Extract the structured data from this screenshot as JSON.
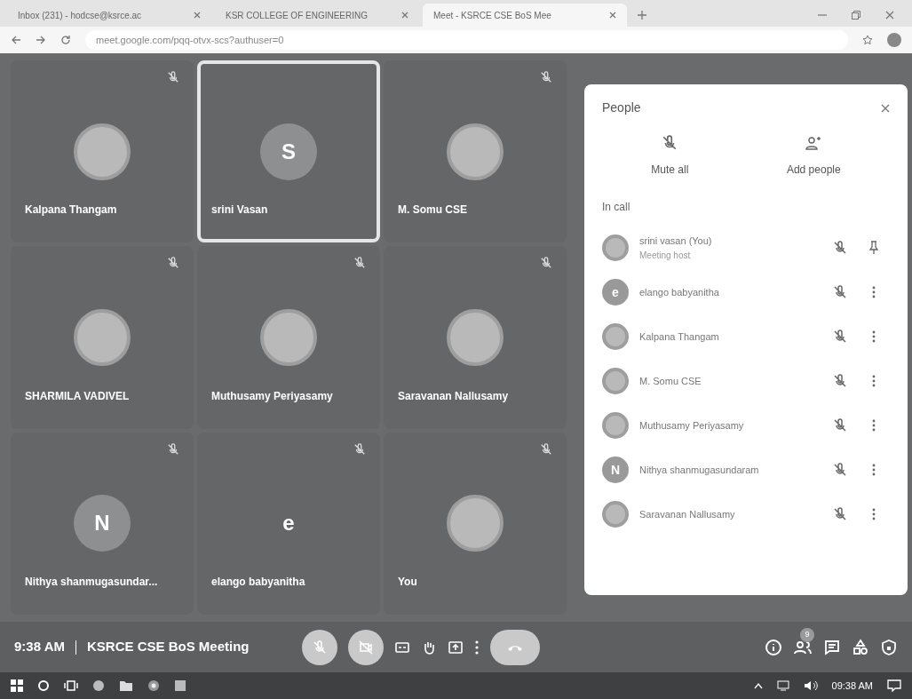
{
  "browser": {
    "tabs": [
      {
        "label": "Inbox (231) - hodcse@ksrce.ac",
        "selected": false
      },
      {
        "label": "KSR COLLEGE OF ENGINEERING",
        "selected": false
      },
      {
        "label": "Meet - KSRCE CSE BoS Mee",
        "selected": true
      }
    ],
    "url": "meet.google.com/pqq-otvx-scs?authuser=0"
  },
  "tiles": [
    {
      "name": "Kalpana Thangam",
      "kind": "photo",
      "muted": true,
      "selected": false
    },
    {
      "name": "srini Vasan",
      "kind": "letter",
      "initial": "S",
      "muted": false,
      "selected": true
    },
    {
      "name": "M. Somu CSE",
      "kind": "photo",
      "muted": true,
      "selected": false
    },
    {
      "name": "SHARMILA VADIVEL",
      "kind": "photo",
      "muted": true,
      "selected": false
    },
    {
      "name": "Muthusamy Periyasamy",
      "kind": "photo",
      "muted": true,
      "selected": false
    },
    {
      "name": "Saravanan Nallusamy",
      "kind": "photo",
      "muted": true,
      "selected": false
    },
    {
      "name": "Nithya shanmugasundar...",
      "kind": "letter",
      "initial": "N",
      "muted": true,
      "selected": false
    },
    {
      "name": "elango babyanitha",
      "kind": "plain",
      "initial": "e",
      "muted": true,
      "selected": false
    },
    {
      "name": "You",
      "kind": "photo",
      "muted": true,
      "selected": false
    }
  ],
  "people_panel": {
    "title": "People",
    "actions": [
      "Mute all",
      "Add people"
    ],
    "section": "In call",
    "participants": [
      {
        "name": "srini vasan (You)",
        "role": "Meeting host",
        "kind": "photo",
        "pinned": true
      },
      {
        "name": "elango babyanitha",
        "kind": "letter",
        "initial": "e",
        "pinned": false
      },
      {
        "name": "Kalpana Thangam",
        "kind": "photo",
        "pinned": false
      },
      {
        "name": "M. Somu CSE",
        "kind": "photo",
        "pinned": false
      },
      {
        "name": "Muthusamy Periyasamy",
        "kind": "photo",
        "pinned": false
      },
      {
        "name": "Nithya shanmugasundaram",
        "kind": "letter",
        "initial": "N",
        "pinned": false
      },
      {
        "name": "Saravanan Nallusamy",
        "kind": "photo",
        "pinned": false
      }
    ]
  },
  "meeting_bar": {
    "time": "9:38 AM",
    "title": "KSRCE CSE BoS Meeting",
    "people_count": "9"
  },
  "taskbar": {
    "clock": "09:38 AM"
  }
}
